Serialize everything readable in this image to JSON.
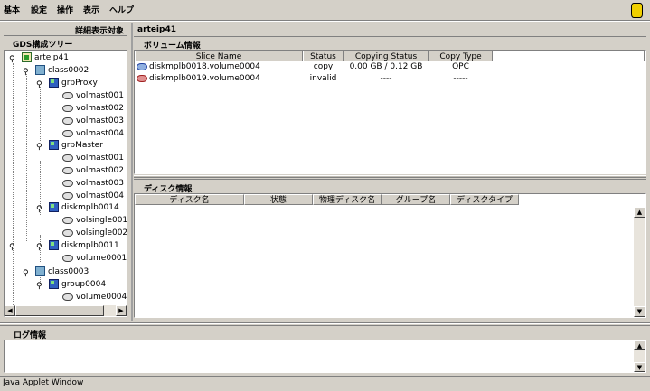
{
  "menu": [
    "基本",
    "設定",
    "操作",
    "表示",
    "ヘルプ"
  ],
  "left": {
    "section_title": "詳細表示対象",
    "tree_title": "GDS構成ツリー",
    "tree": [
      {
        "label": "arteip41",
        "icon": "server-icon"
      },
      {
        "label": "class0002",
        "icon": "class-icon"
      },
      {
        "label": "grpProxy",
        "icon": "group-icon"
      },
      {
        "label": "volmast001",
        "icon": "volume-icon"
      },
      {
        "label": "volmast002",
        "icon": "volume-icon"
      },
      {
        "label": "volmast003",
        "icon": "volume-icon"
      },
      {
        "label": "volmast004",
        "icon": "volume-icon"
      },
      {
        "label": "grpMaster",
        "icon": "group-icon"
      },
      {
        "label": "volmast001",
        "icon": "volume-icon"
      },
      {
        "label": "volmast002",
        "icon": "volume-icon"
      },
      {
        "label": "volmast003",
        "icon": "volume-icon"
      },
      {
        "label": "volmast004",
        "icon": "volume-icon"
      },
      {
        "label": "diskmplb0014",
        "icon": "group-icon"
      },
      {
        "label": "volsingle001",
        "icon": "volume-icon"
      },
      {
        "label": "volsingle002",
        "icon": "volume-icon"
      },
      {
        "label": "diskmplb0011",
        "icon": "group-icon"
      },
      {
        "label": "volume0001",
        "icon": "volume-icon"
      },
      {
        "label": "class0003",
        "icon": "class-icon"
      },
      {
        "label": "group0004",
        "icon": "group-icon"
      },
      {
        "label": "volume0004",
        "icon": "volume-icon"
      }
    ]
  },
  "right": {
    "node_title": "arteip41",
    "volume_panel": {
      "title": "ボリューム情報",
      "columns": [
        "Slice Name",
        "Status",
        "Copying Status",
        "Copy Type"
      ],
      "rows": [
        {
          "name": "diskmplb0018.volume0004",
          "status": "copy",
          "copying": "0.00 GB / 0.12 GB",
          "type": "OPC",
          "icon": "volume-blue-icon"
        },
        {
          "name": "diskmplb0019.volume0004",
          "status": "invalid",
          "copying": "----",
          "type": "-----",
          "icon": "volume-red-icon"
        }
      ]
    },
    "disk_panel": {
      "title": "ディスク情報",
      "columns": [
        "ディスク名",
        "状態",
        "物理ディスク名",
        "グループ名",
        "ディスクタイプ"
      ]
    }
  },
  "log": {
    "title": "ログ情報"
  },
  "status_bar": "Java Applet Window"
}
